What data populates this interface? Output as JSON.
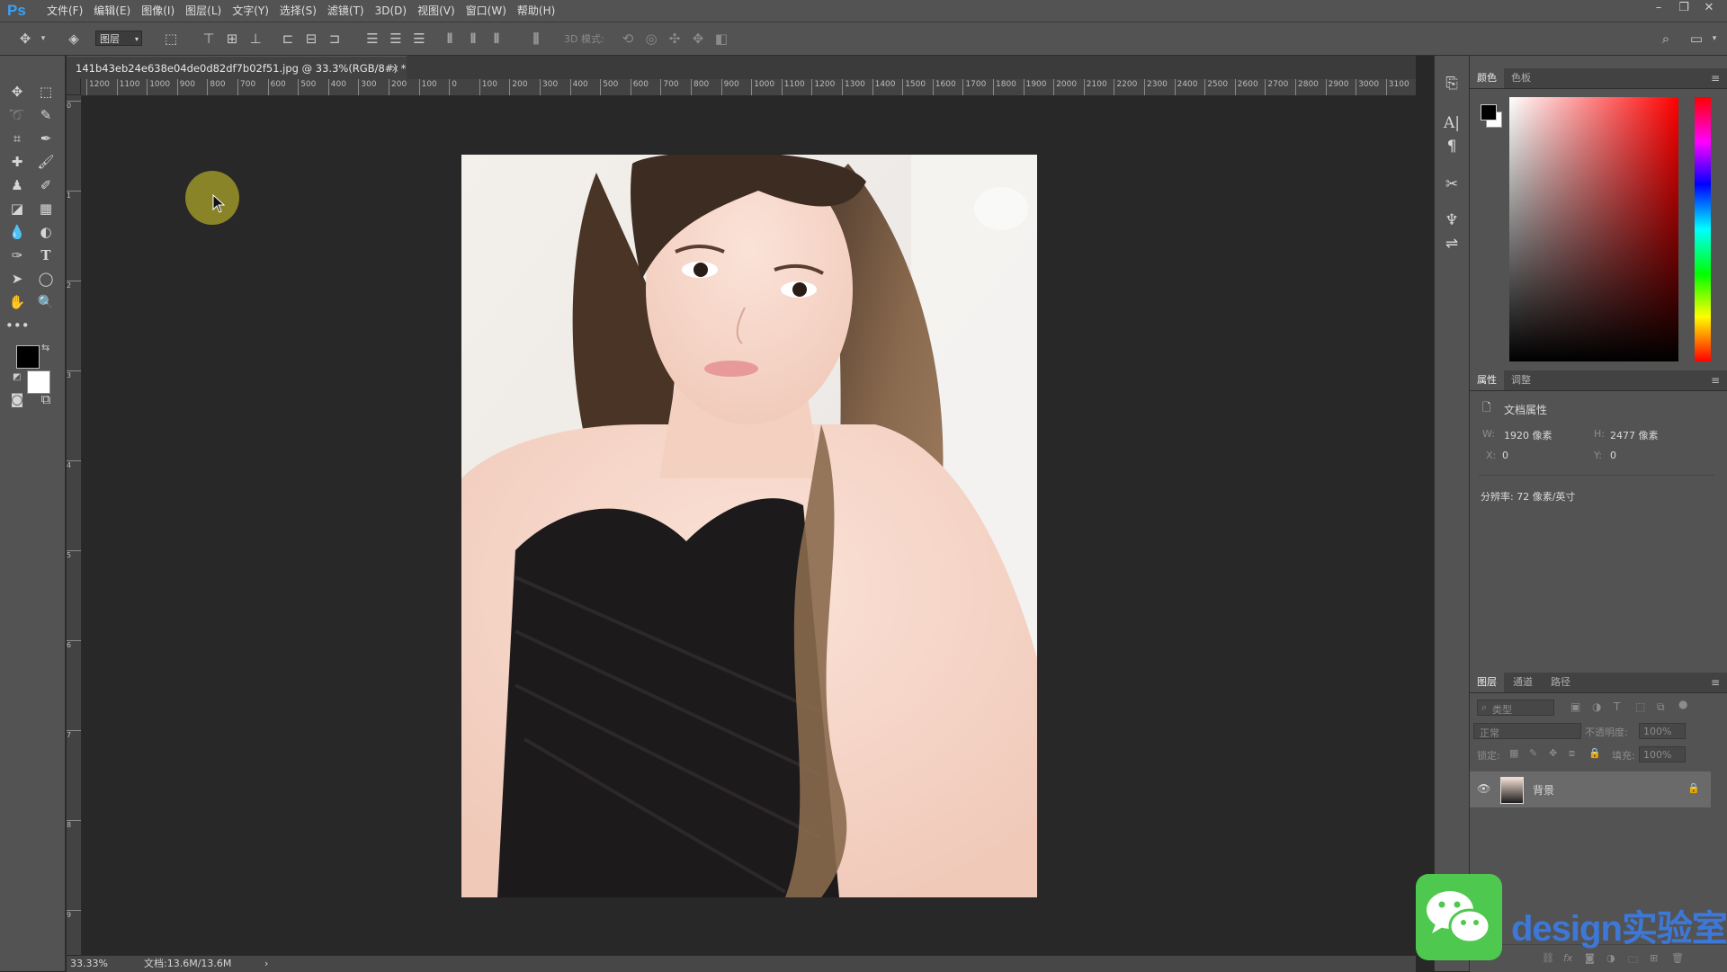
{
  "app": {
    "logo": "Ps",
    "menu": [
      "文件(F)",
      "编辑(E)",
      "图像(I)",
      "图层(L)",
      "文字(Y)",
      "选择(S)",
      "滤镜(T)",
      "3D(D)",
      "视图(V)",
      "窗口(W)",
      "帮助(H)"
    ],
    "window_controls": [
      "–",
      "❐",
      "✕"
    ]
  },
  "options_bar": {
    "layer_select": "图层",
    "mode3d_label": "3D 模式:"
  },
  "document": {
    "tab_title": "141b43eb24e638e04de0d82df7b02f51.jpg @ 33.3%(RGB/8#) *",
    "close": "×",
    "ruler_h": [
      "1200",
      "1100",
      "1000",
      "900",
      "800",
      "700",
      "600",
      "500",
      "400",
      "300",
      "200",
      "100",
      "0",
      "100",
      "200",
      "300",
      "400",
      "500",
      "600",
      "700",
      "800",
      "900",
      "1000",
      "1100",
      "1200",
      "1300",
      "1400",
      "1500",
      "1600",
      "1700",
      "1800",
      "1900",
      "2000",
      "2100",
      "2200",
      "2300",
      "2400",
      "2500",
      "2600",
      "2700",
      "2800",
      "2900",
      "3000",
      "3100"
    ],
    "ruler_v": [
      "0",
      "1",
      "2",
      "3",
      "4",
      "5",
      "6",
      "7",
      "8",
      "9"
    ]
  },
  "status": {
    "zoom": "33.33%",
    "doc_size": "文档:13.6M/13.6M",
    "arrow": "›"
  },
  "panels": {
    "color": {
      "tabs": [
        "颜色",
        "色板"
      ],
      "accent": "#ff0000"
    },
    "properties": {
      "tabs": [
        "属性",
        "调整"
      ],
      "title": "文档属性",
      "w_label": "W:",
      "w_value": "1920 像素",
      "h_label": "H:",
      "h_value": "2477 像素",
      "x_label": "X:",
      "x_value": "0",
      "y_label": "Y:",
      "y_value": "0",
      "resolution": "分辨率: 72 像素/英寸"
    },
    "layers": {
      "tabs": [
        "图层",
        "通道",
        "路径"
      ],
      "filter_placeholder": "类型",
      "blend_mode": "正常",
      "opacity_label": "不透明度:",
      "opacity_value": "100%",
      "lock_label": "锁定:",
      "fill_label": "填充:",
      "fill_value": "100%",
      "layer_name": "背景"
    },
    "menu_icon": "≡"
  },
  "watermark": {
    "text": "design实验室"
  }
}
